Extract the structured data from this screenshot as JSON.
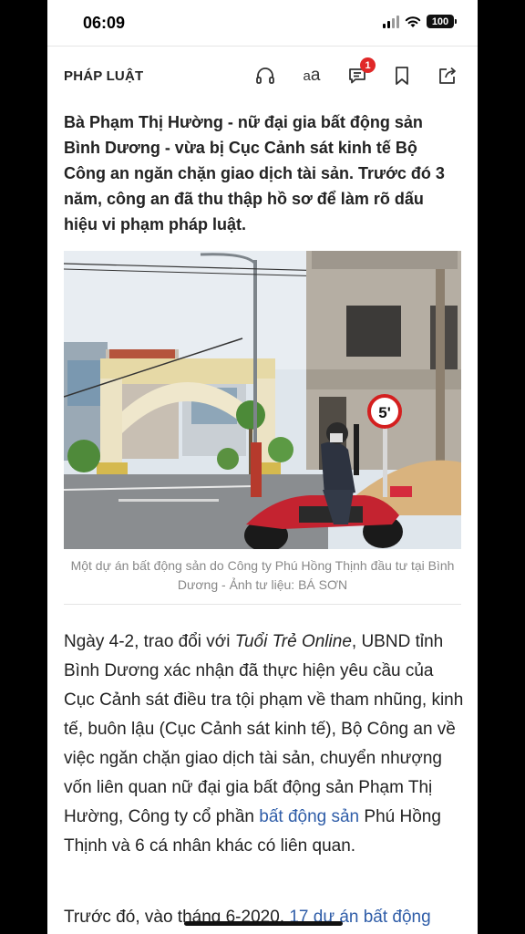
{
  "status_bar": {
    "time": "06:09",
    "battery": "100"
  },
  "toolbar": {
    "section": "PHÁP LUẬT",
    "font_size_label_small": "a",
    "font_size_label_large": "a",
    "comment_count": "1",
    "icons": [
      "headphones-icon",
      "font-size-icon",
      "comment-icon",
      "bookmark-icon",
      "share-icon"
    ]
  },
  "article": {
    "sapo": "Bà Phạm Thị Hường - nữ đại gia bất động sản Bình Dương - vừa bị Cục Cảnh sát kinh tế Bộ Công an ngăn chặn giao dịch tài sản. Trước đó 3 năm, công an đã thu thập hồ sơ để làm rõ dấu hiệu vi phạm pháp luật.",
    "image_caption": "Một dự án bất động sản do Công ty Phú Hồng Thịnh đầu tư tại Bình Dương - Ảnh tư liệu: BÁ SƠN",
    "image_sign_text": "5'",
    "p1_a": "Ngày 4-2, trao đổi với ",
    "p1_source": "Tuổi Trẻ Online",
    "p1_b": ", UBND tỉnh Bình Dương xác nhận đã thực hiện yêu cầu của Cục Cảnh sát điều tra tội phạm về tham nhũng, kinh tế, buôn lậu (Cục Cảnh sát kinh tế), Bộ Công an về việc ngăn chặn giao dịch tài sản, chuyển nhượng vốn liên quan nữ đại gia bất động sản Phạm Thị Hường, Công ty cổ phần ",
    "p1_link": "bất động sản",
    "p1_c": " Phú Hồng Thịnh và 6 cá nhân khác có liên quan.",
    "p2_a": "Trước đó, vào tháng 6-2020, ",
    "p2_link": "17 dự án bất động"
  },
  "colors": {
    "link": "#2f5da8",
    "badge": "#e02828",
    "text": "#222222",
    "caption": "#888888"
  }
}
